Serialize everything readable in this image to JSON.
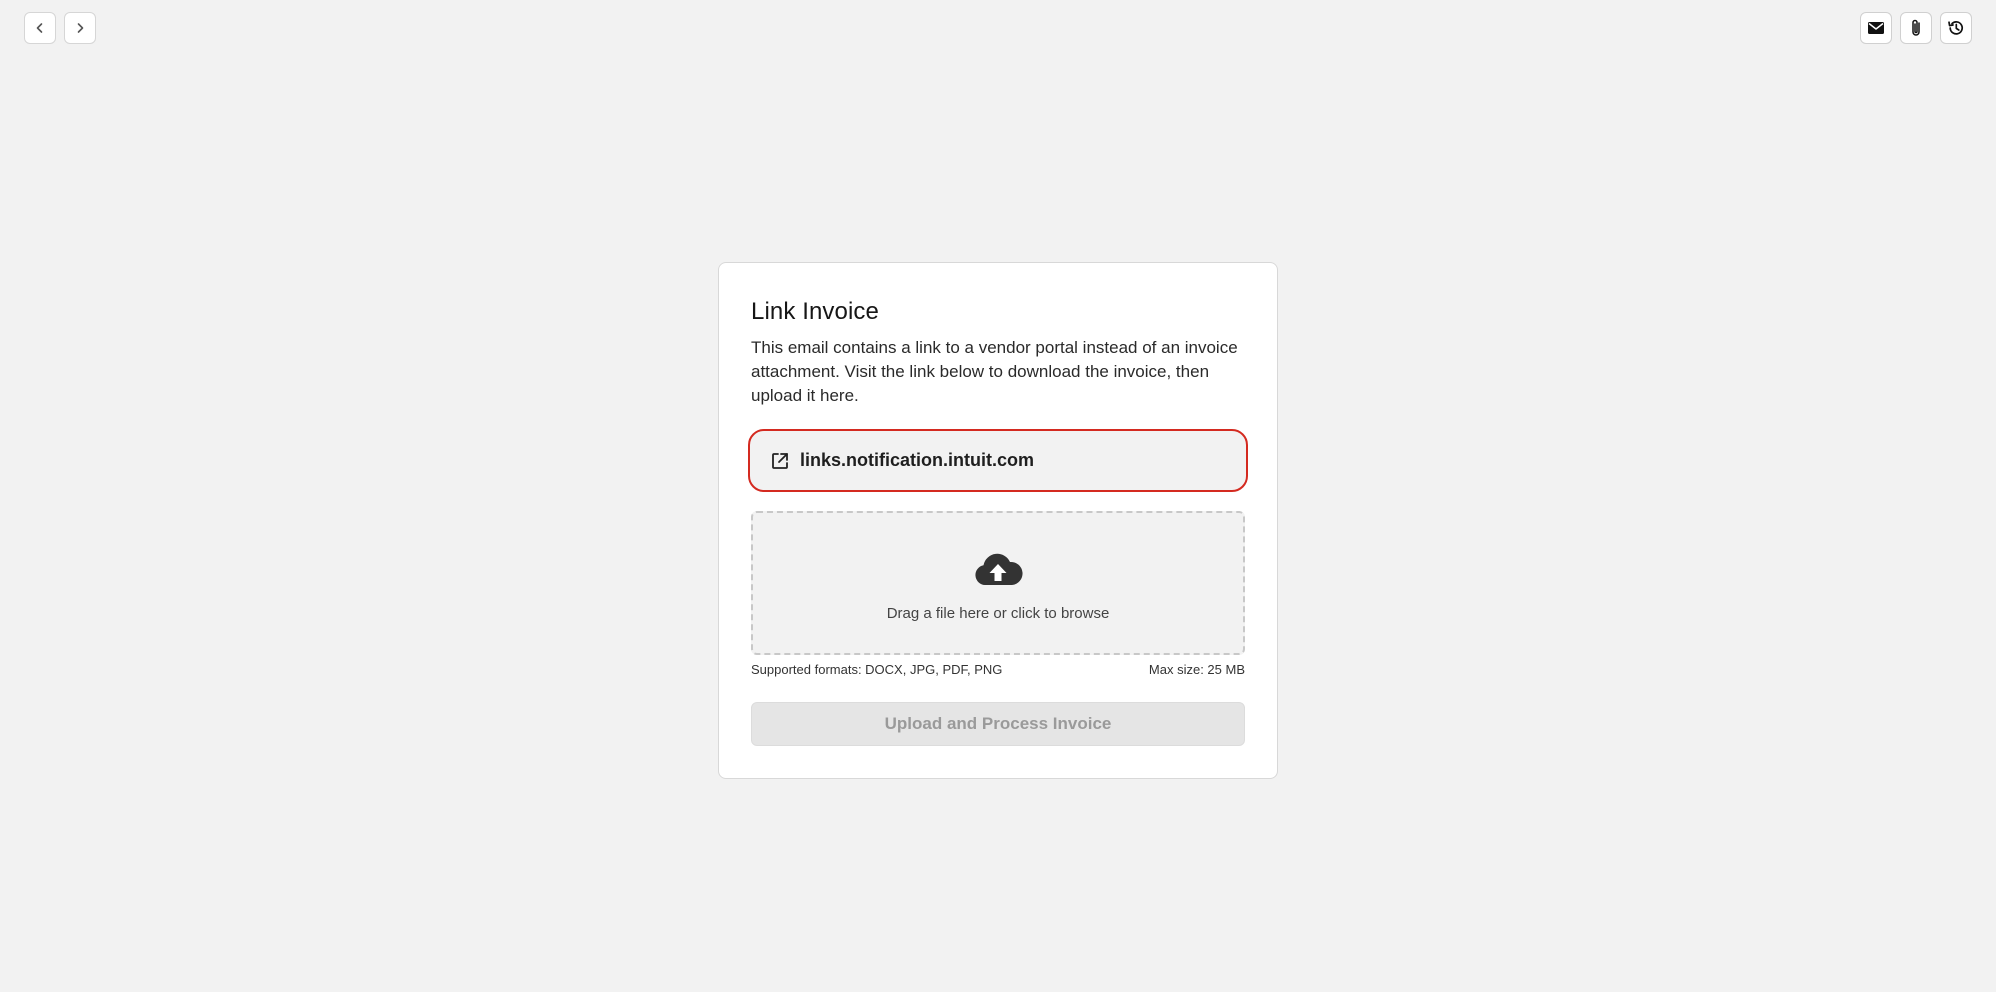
{
  "toolbar": {
    "back_icon": "chevron-left-icon",
    "forward_icon": "chevron-right-icon",
    "email_icon": "envelope-icon",
    "attachment_icon": "paperclip-icon",
    "history_icon": "history-icon"
  },
  "card": {
    "title": "Link Invoice",
    "description": "This email contains a link to a vendor portal instead of an invoice attachment. Visit the link below to download the invoice, then upload it here.",
    "link": {
      "icon": "external-link-icon",
      "text": "links.notification.intuit.com",
      "highlight_color": "#d42a20"
    },
    "dropzone": {
      "icon": "cloud-upload-icon",
      "text": "Drag a file here or click to browse"
    },
    "supported_formats": "Supported formats: DOCX, JPG, PDF, PNG",
    "max_size": "Max size: 25 MB",
    "submit_label": "Upload and Process Invoice",
    "submit_disabled": true
  },
  "colors": {
    "background": "#f2f2f2",
    "card": "#ffffff",
    "accent_border": "#d42a20",
    "disabled_button": "#e5e5e5"
  }
}
